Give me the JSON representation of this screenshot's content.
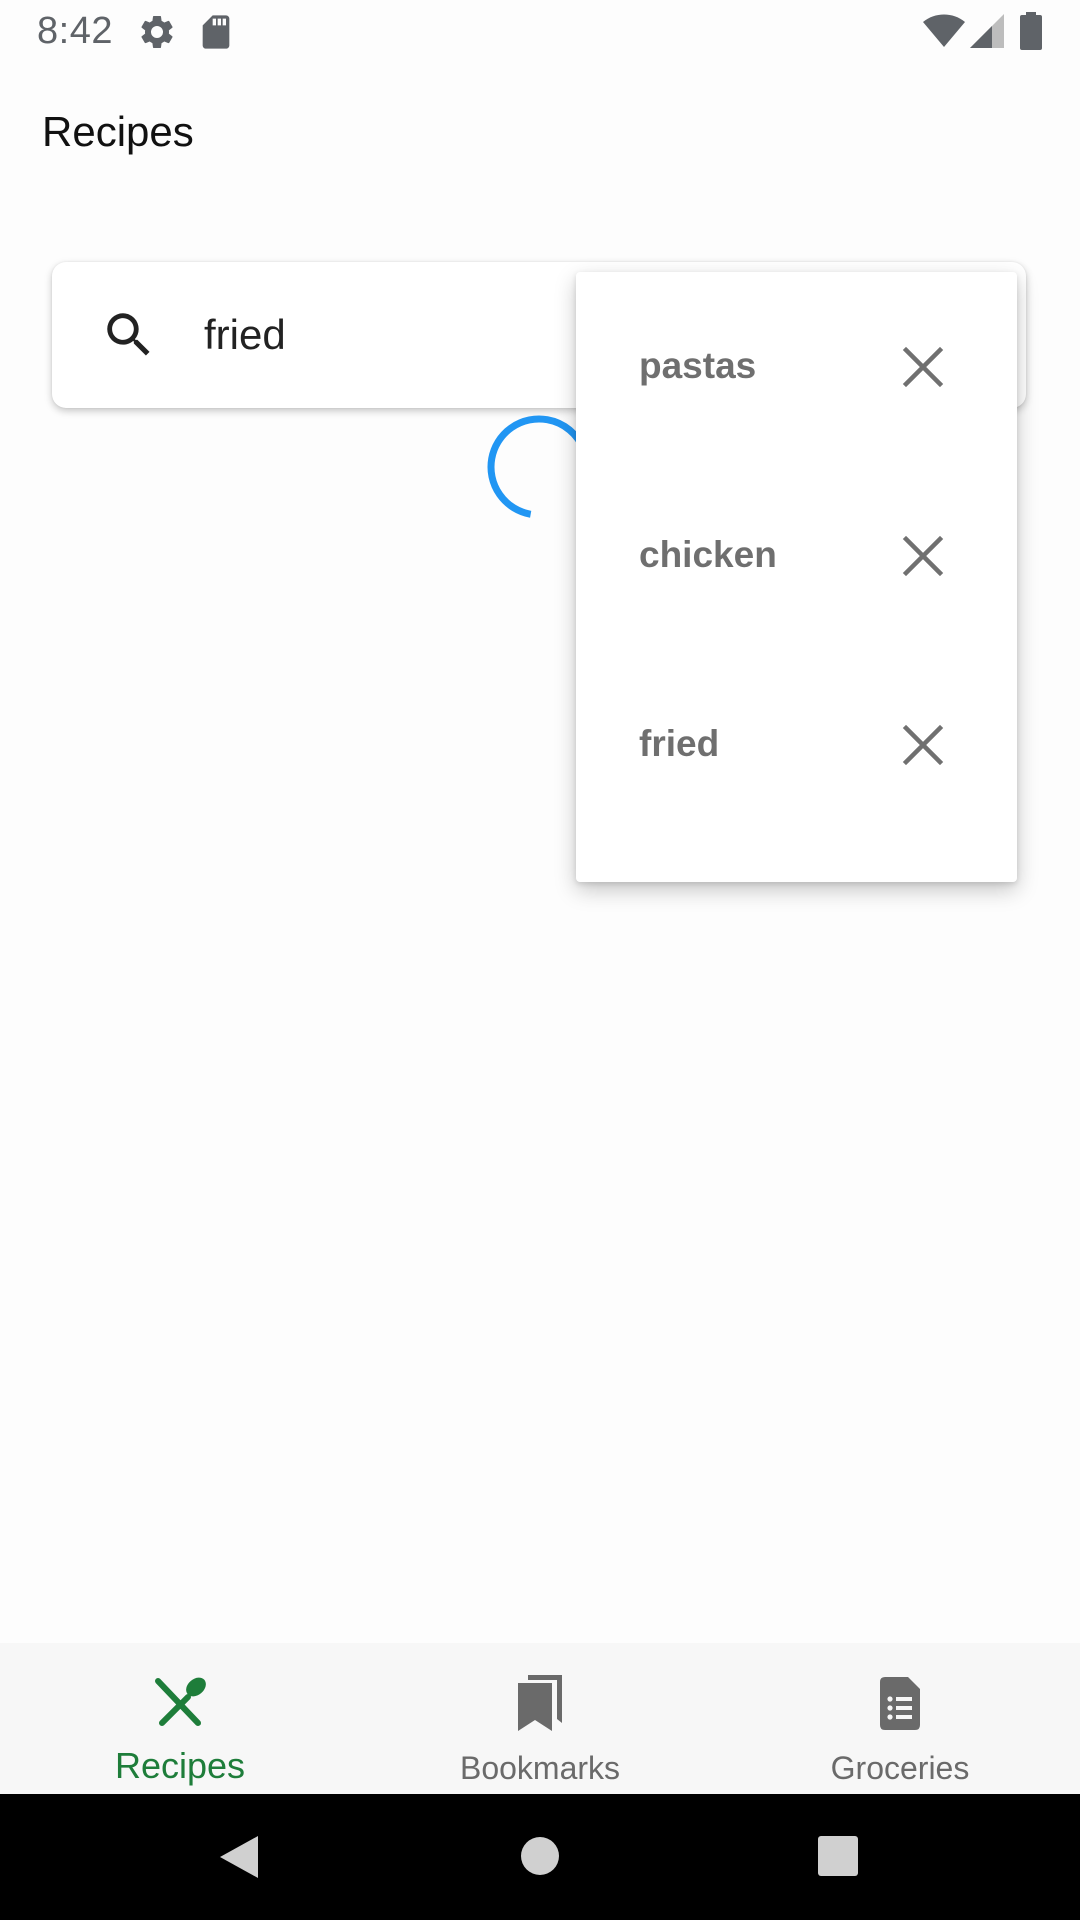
{
  "status_bar": {
    "time": "8:42",
    "icons": [
      "gear-icon",
      "sd-card-icon",
      "wifi-icon",
      "cell-signal-icon",
      "battery-icon"
    ]
  },
  "app_bar": {
    "title": "Recipes"
  },
  "search": {
    "value": "fried",
    "icon": "search-icon"
  },
  "loading": {
    "spinner_color": "#2196f3"
  },
  "suggestions": {
    "items": [
      {
        "label": "pastas"
      },
      {
        "label": "chicken"
      },
      {
        "label": "fried"
      }
    ],
    "remove_icon": "close-icon"
  },
  "bottom_nav": {
    "active_color": "#1e7d3a",
    "inactive_color": "#6a6a6a",
    "items": [
      {
        "label": "Recipes",
        "icon": "fork-knife-icon",
        "active": true
      },
      {
        "label": "Bookmarks",
        "icon": "bookmarks-icon",
        "active": false
      },
      {
        "label": "Groceries",
        "icon": "list-icon",
        "active": false
      }
    ]
  },
  "system_nav": {
    "buttons": [
      "back-icon",
      "home-icon",
      "recents-icon"
    ]
  }
}
